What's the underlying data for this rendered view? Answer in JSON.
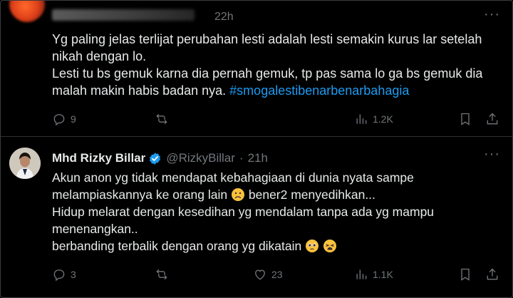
{
  "tweet1": {
    "time": "22h",
    "lines": [
      "Yg paling jelas terlijat perubahan lesti adalah lesti semakin kurus lar setelah",
      "nikah dengan lo.",
      "Lesti tu bs gemuk karna dia pernah gemuk, tp pas sama lo ga bs gemuk dia",
      "malah makin habis badan nya."
    ],
    "hashtag": "#smogalestibenarbenarbahagia",
    "replies": "9",
    "views": "1.2K"
  },
  "tweet2": {
    "name": "Mhd Rizky Billar",
    "handle": "@RizkyBillar",
    "separator": "·",
    "time": "21h",
    "lines": [
      "Akun anon yg tidak mendapat kebahagiaan di dunia nyata sampe",
      "melampiaskannya ke orang lain",
      "bener2 menyedihkan...",
      "Hidup melarat dengan kesedihan yg mendalam tanpa ada yg mampu",
      "menenangkan..",
      "berbanding terbalik dengan orang yg dikatain"
    ],
    "replies": "3",
    "likes": "23",
    "views": "1.1K"
  },
  "colors": {
    "accent": "#1d9bf0",
    "muted": "#71767b",
    "text": "#e7e9ea",
    "background": "#000000"
  },
  "icons": [
    "more-icon",
    "reply-icon",
    "retweet-icon",
    "like-icon",
    "views-icon",
    "bookmark-icon",
    "share-icon",
    "verified-badge-icon",
    "sad-face-emoji",
    "pleading-face-emoji",
    "weary-face-emoji"
  ]
}
